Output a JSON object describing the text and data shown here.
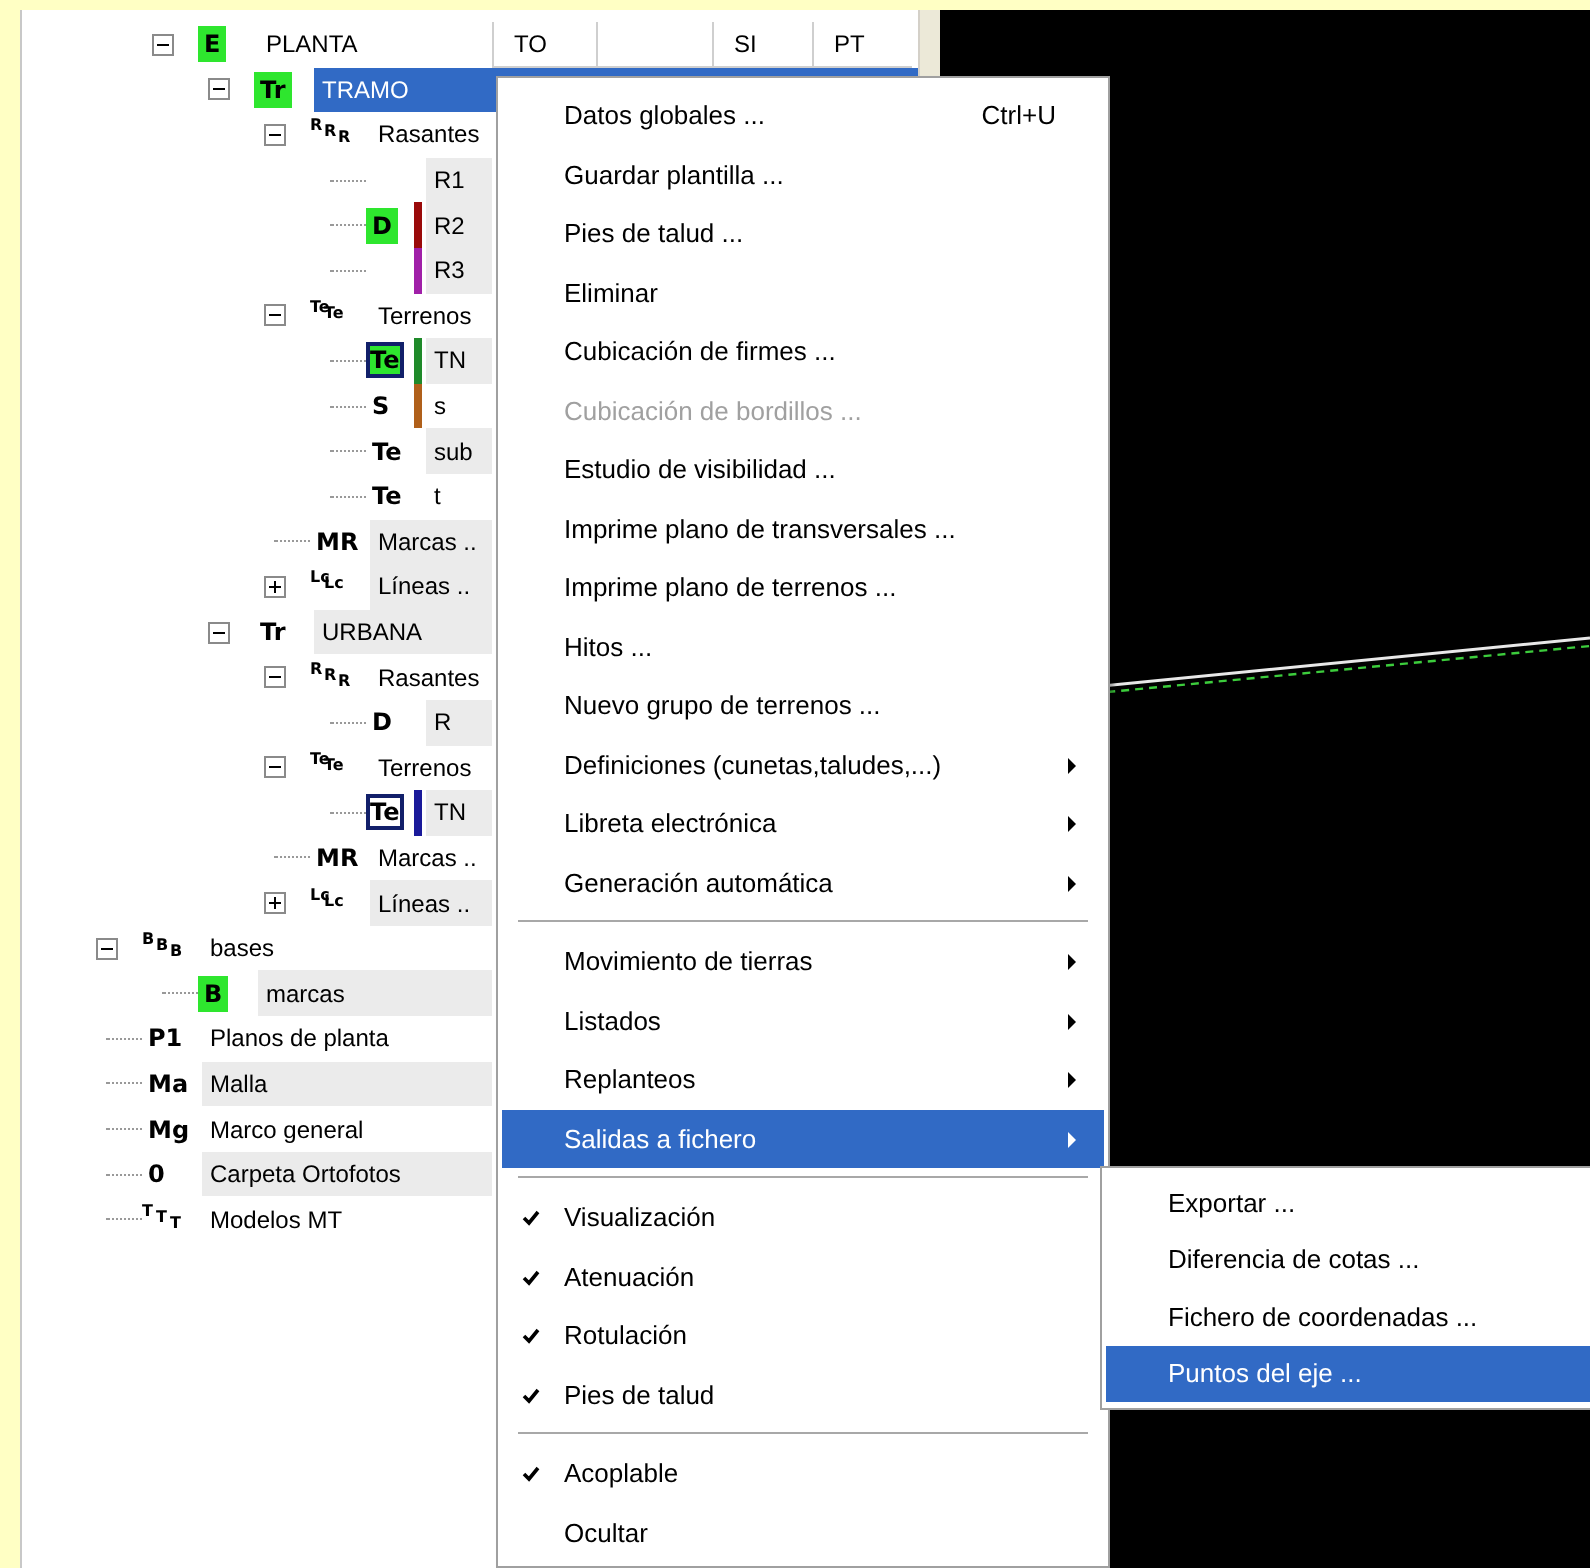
{
  "tree": [
    {
      "children": [
        {
          "label": "PLANTA",
          "icon": {
            "glyphs": [
              "E"
            ],
            "kind": "badge"
          },
          "expanded": true,
          "selected": false,
          "shaded": false,
          "cells": {
            "column_1": "TO",
            "column_3": "SI",
            "column_4": "PT"
          },
          "children": [
            {
              "label": "TRAMO",
              "icon": {
                "glyphs": [
                  "Tr"
                ],
                "kind": "badge"
              },
              "expanded": true,
              "selected": true,
              "shaded": false,
              "children": [
                {
                  "label": "Rasantes",
                  "icon": {
                    "glyphs": [
                      "R",
                      "R",
                      "R"
                    ],
                    "kind": "glyph"
                  },
                  "expanded": true,
                  "selected": false,
                  "shaded": false,
                  "children": [
                    {
                      "label": "R1",
                      "selected": false,
                      "shaded": true
                    },
                    {
                      "label": "R2",
                      "icon": {
                        "glyphs": [
                          "D"
                        ],
                        "kind": "badge"
                      },
                      "color": "#9a0a0a",
                      "selected": false,
                      "shaded": true
                    },
                    {
                      "label": "R3",
                      "color": "#a020a8",
                      "selected": false,
                      "shaded": true
                    }
                  ]
                },
                {
                  "label": "Terrenos",
                  "icon": {
                    "glyphs": [
                      "Te",
                      "Te"
                    ],
                    "kind": "glyph"
                  },
                  "expanded": true,
                  "selected": false,
                  "shaded": false,
                  "children": [
                    {
                      "label": "TN",
                      "icon": {
                        "glyphs": [
                          "Te"
                        ],
                        "kind": "boxed_badge"
                      },
                      "color": "#1f8a2a",
                      "selected": false,
                      "shaded": true
                    },
                    {
                      "label": "s",
                      "icon": {
                        "glyphs": [
                          "S"
                        ],
                        "kind": "glyph"
                      },
                      "color": "#b0601a",
                      "selected": false,
                      "shaded": false
                    },
                    {
                      "label": "sub",
                      "icon": {
                        "glyphs": [
                          "Te"
                        ],
                        "kind": "glyph"
                      },
                      "selected": false,
                      "shaded": true
                    },
                    {
                      "label": "t",
                      "icon": {
                        "glyphs": [
                          "Te"
                        ],
                        "kind": "glyph"
                      },
                      "selected": false,
                      "shaded": false
                    }
                  ]
                },
                {
                  "label": "Marcas ..",
                  "icon": {
                    "glyphs": [
                      "MR"
                    ],
                    "kind": "glyph"
                  },
                  "selected": false,
                  "shaded": true
                },
                {
                  "label": "Líneas ..",
                  "icon": {
                    "glyphs": [
                      "Lc",
                      "Lc"
                    ],
                    "kind": "glyph"
                  },
                  "expanded": false,
                  "selected": false,
                  "shaded": true
                }
              ]
            },
            {
              "label": "URBANA",
              "icon": {
                "glyphs": [
                  "Tr"
                ],
                "kind": "glyph"
              },
              "expanded": true,
              "selected": false,
              "shaded": true,
              "children": [
                {
                  "label": "Rasantes",
                  "icon": {
                    "glyphs": [
                      "R",
                      "R",
                      "R"
                    ],
                    "kind": "glyph"
                  },
                  "expanded": true,
                  "selected": false,
                  "shaded": false,
                  "children": [
                    {
                      "label": "R",
                      "icon": {
                        "glyphs": [
                          "D"
                        ],
                        "kind": "glyph"
                      },
                      "selected": false,
                      "shaded": true
                    }
                  ]
                },
                {
                  "label": "Terrenos",
                  "icon": {
                    "glyphs": [
                      "Te",
                      "Te"
                    ],
                    "kind": "glyph"
                  },
                  "expanded": true,
                  "selected": false,
                  "shaded": false,
                  "children": [
                    {
                      "label": "TN",
                      "icon": {
                        "glyphs": [
                          "Te"
                        ],
                        "kind": "boxed"
                      },
                      "color": "#1a1a9a",
                      "selected": false,
                      "shaded": true
                    }
                  ]
                },
                {
                  "label": "Marcas ..",
                  "icon": {
                    "glyphs": [
                      "MR"
                    ],
                    "kind": "glyph"
                  },
                  "selected": false,
                  "shaded": false
                },
                {
                  "label": "Líneas ..",
                  "icon": {
                    "glyphs": [
                      "Lc",
                      "Lc"
                    ],
                    "kind": "glyph"
                  },
                  "expanded": false,
                  "selected": false,
                  "shaded": true
                }
              ]
            }
          ]
        }
      ]
    },
    {
      "label": "bases",
      "icon": {
        "glyphs": [
          "B",
          "B",
          "B"
        ],
        "kind": "glyph"
      },
      "expanded": true,
      "selected": false,
      "shaded": false,
      "children": [
        {
          "label": "marcas",
          "icon": {
            "glyphs": [
              "B"
            ],
            "kind": "badge"
          },
          "selected": false,
          "shaded": true
        }
      ]
    },
    {
      "label": "Planos de planta",
      "icon": {
        "glyphs": [
          "P1"
        ],
        "kind": "glyph"
      },
      "selected": false,
      "shaded": false
    },
    {
      "label": "Malla",
      "icon": {
        "glyphs": [
          "Ma"
        ],
        "kind": "glyph"
      },
      "selected": false,
      "shaded": true
    },
    {
      "label": "Marco general",
      "icon": {
        "glyphs": [
          "Mg"
        ],
        "kind": "glyph"
      },
      "selected": false,
      "shaded": false
    },
    {
      "label": "Carpeta Ortofotos",
      "icon": {
        "glyphs": [
          "0"
        ],
        "kind": "glyph"
      },
      "selected": false,
      "shaded": true
    },
    {
      "label": "Modelos MT",
      "icon": {
        "glyphs": [
          "T",
          "T",
          "T"
        ],
        "kind": "glyph"
      },
      "selected": false,
      "shaded": false
    }
  ],
  "context_menu": {
    "items": [
      {
        "kind": "item",
        "label": "Datos globales ...",
        "shortcut": "Ctrl+U",
        "disabled": false,
        "checked": false,
        "submenu": false,
        "selected": false
      },
      {
        "kind": "item",
        "label": "Guardar plantilla ...",
        "disabled": false,
        "checked": false,
        "submenu": false,
        "selected": false
      },
      {
        "kind": "item",
        "label": "Pies de talud ...",
        "disabled": false,
        "checked": false,
        "submenu": false,
        "selected": false
      },
      {
        "kind": "item",
        "label": "Eliminar",
        "disabled": false,
        "checked": false,
        "submenu": false,
        "selected": false
      },
      {
        "kind": "item",
        "label": "Cubicación de firmes ...",
        "disabled": false,
        "checked": false,
        "submenu": false,
        "selected": false
      },
      {
        "kind": "item",
        "label": "Cubicación de bordillos ...",
        "disabled": true,
        "checked": false,
        "submenu": false,
        "selected": false
      },
      {
        "kind": "item",
        "label": "Estudio de visibilidad ...",
        "disabled": false,
        "checked": false,
        "submenu": false,
        "selected": false
      },
      {
        "kind": "item",
        "label": "Imprime plano de transversales ...",
        "disabled": false,
        "checked": false,
        "submenu": false,
        "selected": false
      },
      {
        "kind": "item",
        "label": "Imprime plano de terrenos ...",
        "disabled": false,
        "checked": false,
        "submenu": false,
        "selected": false
      },
      {
        "kind": "item",
        "label": "Hitos ...",
        "disabled": false,
        "checked": false,
        "submenu": false,
        "selected": false
      },
      {
        "kind": "item",
        "label": "Nuevo grupo de terrenos ...",
        "disabled": false,
        "checked": false,
        "submenu": false,
        "selected": false
      },
      {
        "kind": "item",
        "label": "Definiciones (cunetas,taludes,...)",
        "disabled": false,
        "checked": false,
        "submenu": true,
        "selected": false
      },
      {
        "kind": "item",
        "label": "Libreta electrónica",
        "disabled": false,
        "checked": false,
        "submenu": true,
        "selected": false
      },
      {
        "kind": "item",
        "label": "Generación automática",
        "disabled": false,
        "checked": false,
        "submenu": true,
        "selected": false
      },
      {
        "kind": "separator"
      },
      {
        "kind": "item",
        "label": "Movimiento de tierras",
        "disabled": false,
        "checked": false,
        "submenu": true,
        "selected": false
      },
      {
        "kind": "item",
        "label": "Listados",
        "disabled": false,
        "checked": false,
        "submenu": true,
        "selected": false
      },
      {
        "kind": "item",
        "label": "Replanteos",
        "disabled": false,
        "checked": false,
        "submenu": true,
        "selected": false
      },
      {
        "kind": "item",
        "label": "Salidas a fichero",
        "disabled": false,
        "checked": false,
        "submenu": true,
        "selected": true
      },
      {
        "kind": "separator"
      },
      {
        "kind": "item",
        "label": "Visualización",
        "disabled": false,
        "checked": true,
        "submenu": false,
        "selected": false
      },
      {
        "kind": "item",
        "label": "Atenuación",
        "disabled": false,
        "checked": true,
        "submenu": false,
        "selected": false
      },
      {
        "kind": "item",
        "label": "Rotulación",
        "disabled": false,
        "checked": true,
        "submenu": false,
        "selected": false
      },
      {
        "kind": "item",
        "label": "Pies de talud",
        "disabled": false,
        "checked": true,
        "submenu": false,
        "selected": false
      },
      {
        "kind": "separator"
      },
      {
        "kind": "item",
        "label": "Acoplable",
        "disabled": false,
        "checked": true,
        "submenu": false,
        "selected": false
      },
      {
        "kind": "item",
        "label": "Ocultar",
        "disabled": false,
        "checked": false,
        "submenu": false,
        "selected": false
      }
    ]
  },
  "submenu": {
    "items": [
      {
        "label": "Exportar ...",
        "selected": false
      },
      {
        "label": "Diferencia de cotas ...",
        "selected": false
      },
      {
        "label": "Fichero de coordenadas ...",
        "selected": false
      },
      {
        "label": "Puntos del eje ...",
        "selected": true
      }
    ]
  }
}
